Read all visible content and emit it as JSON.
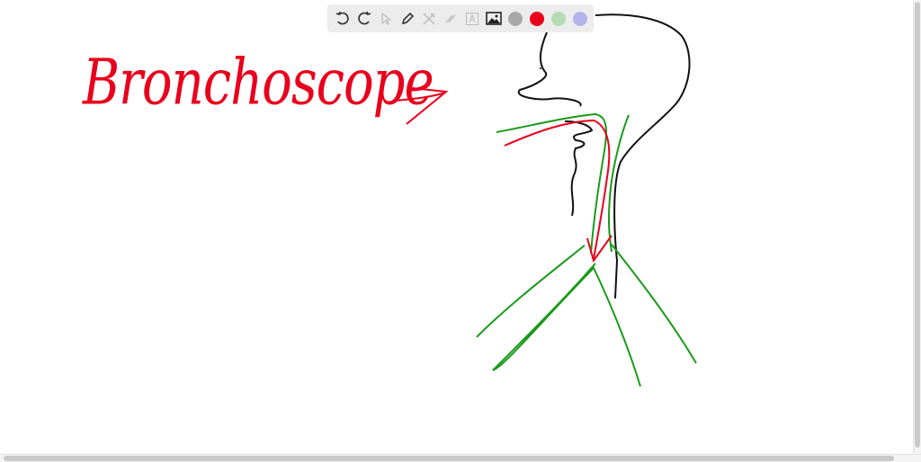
{
  "toolbar": {
    "tools": [
      "undo-icon",
      "redo-icon",
      "select-icon",
      "pen-icon",
      "tools-icon",
      "eraser-icon",
      "text-icon",
      "image-icon"
    ],
    "colors": [
      "#a8a8a8",
      "#e8001c",
      "#b5dbb3",
      "#b3b3ea"
    ]
  },
  "drawing": {
    "label": "Bronchoscope",
    "ink_colors": {
      "black": "#111111",
      "red": "#e8001c",
      "green": "#1a9a1a"
    }
  }
}
